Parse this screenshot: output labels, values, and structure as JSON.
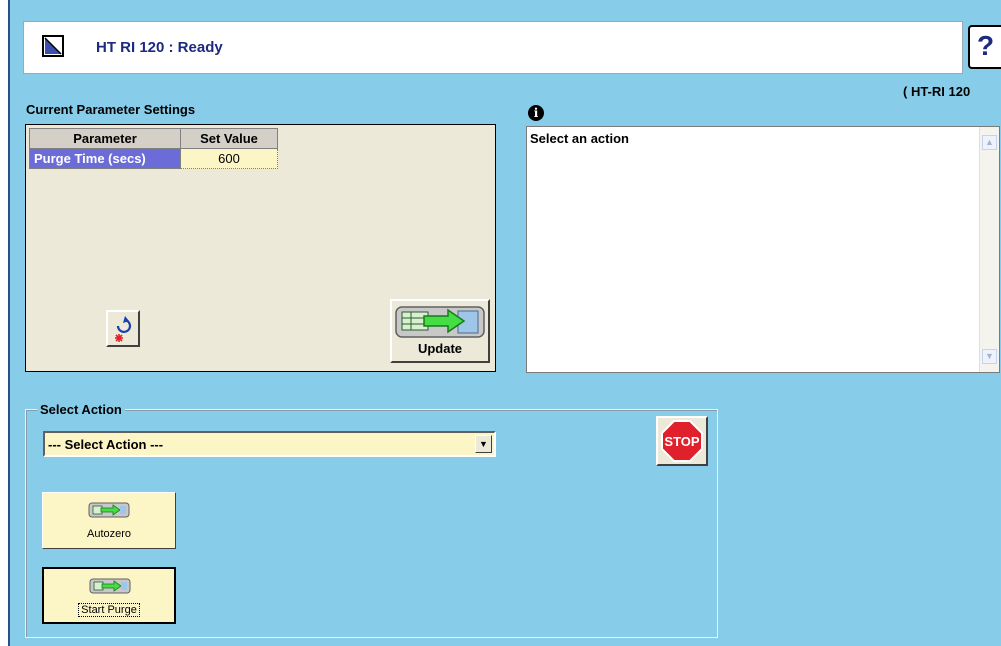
{
  "header": {
    "title": "HT RI 120 : Ready",
    "help_label": "?",
    "device_tag": "( HT-RI 120"
  },
  "parameters": {
    "section_title": "Current Parameter Settings",
    "columns": [
      "Parameter",
      "Set Value"
    ],
    "rows": [
      {
        "name": "Purge Time (secs)",
        "value": "600"
      }
    ],
    "update_label": "Update"
  },
  "info": {
    "icon_glyph": "i",
    "message": "Select an action"
  },
  "actions": {
    "group_title": "Select Action",
    "selected": "--- Select Action ---",
    "stop_label": "STOP",
    "buttons": [
      {
        "label": "Autozero"
      },
      {
        "label": "Start Purge"
      }
    ]
  },
  "colors": {
    "background": "#87cdea",
    "param_name_bg": "#6c6cd8",
    "value_bg": "#fcf6c6",
    "title_text": "#1c2a80",
    "stop_red": "#e0202a"
  }
}
